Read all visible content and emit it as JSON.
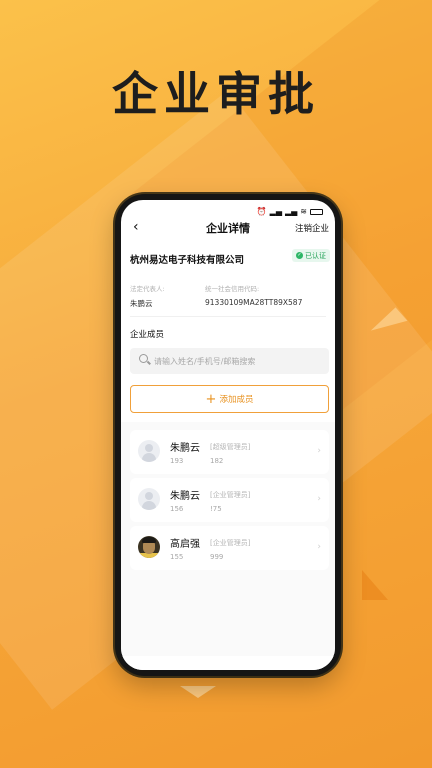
{
  "headline": "企业审批",
  "header": {
    "title": "企业详情",
    "action_label": "注销企业"
  },
  "company": {
    "name": "杭州易达电子科技有限公司",
    "badge": "已认证",
    "legal_rep_label": "法定代表人:",
    "legal_rep_value": "朱鹏云",
    "credit_code_label": "统一社会信用代码:",
    "credit_code_value": "91330109MA28TT89X587"
  },
  "members_section": {
    "title": "企业成员",
    "search_placeholder": "请输入姓名/手机号/邮箱搜索",
    "add_label": "添加成员",
    "members": [
      {
        "name": "朱鹏云",
        "role": "[超级管理员]",
        "phone_a": "193",
        "phone_b": "182"
      },
      {
        "name": "朱鹏云",
        "role": "[企业管理员]",
        "phone_a": "156",
        "phone_b": "!75"
      },
      {
        "name": "高启强",
        "role": "[企业管理员]",
        "phone_a": "155",
        "phone_b": "999"
      }
    ]
  },
  "colors": {
    "accent": "#e8911e",
    "verified": "#27a35a"
  }
}
